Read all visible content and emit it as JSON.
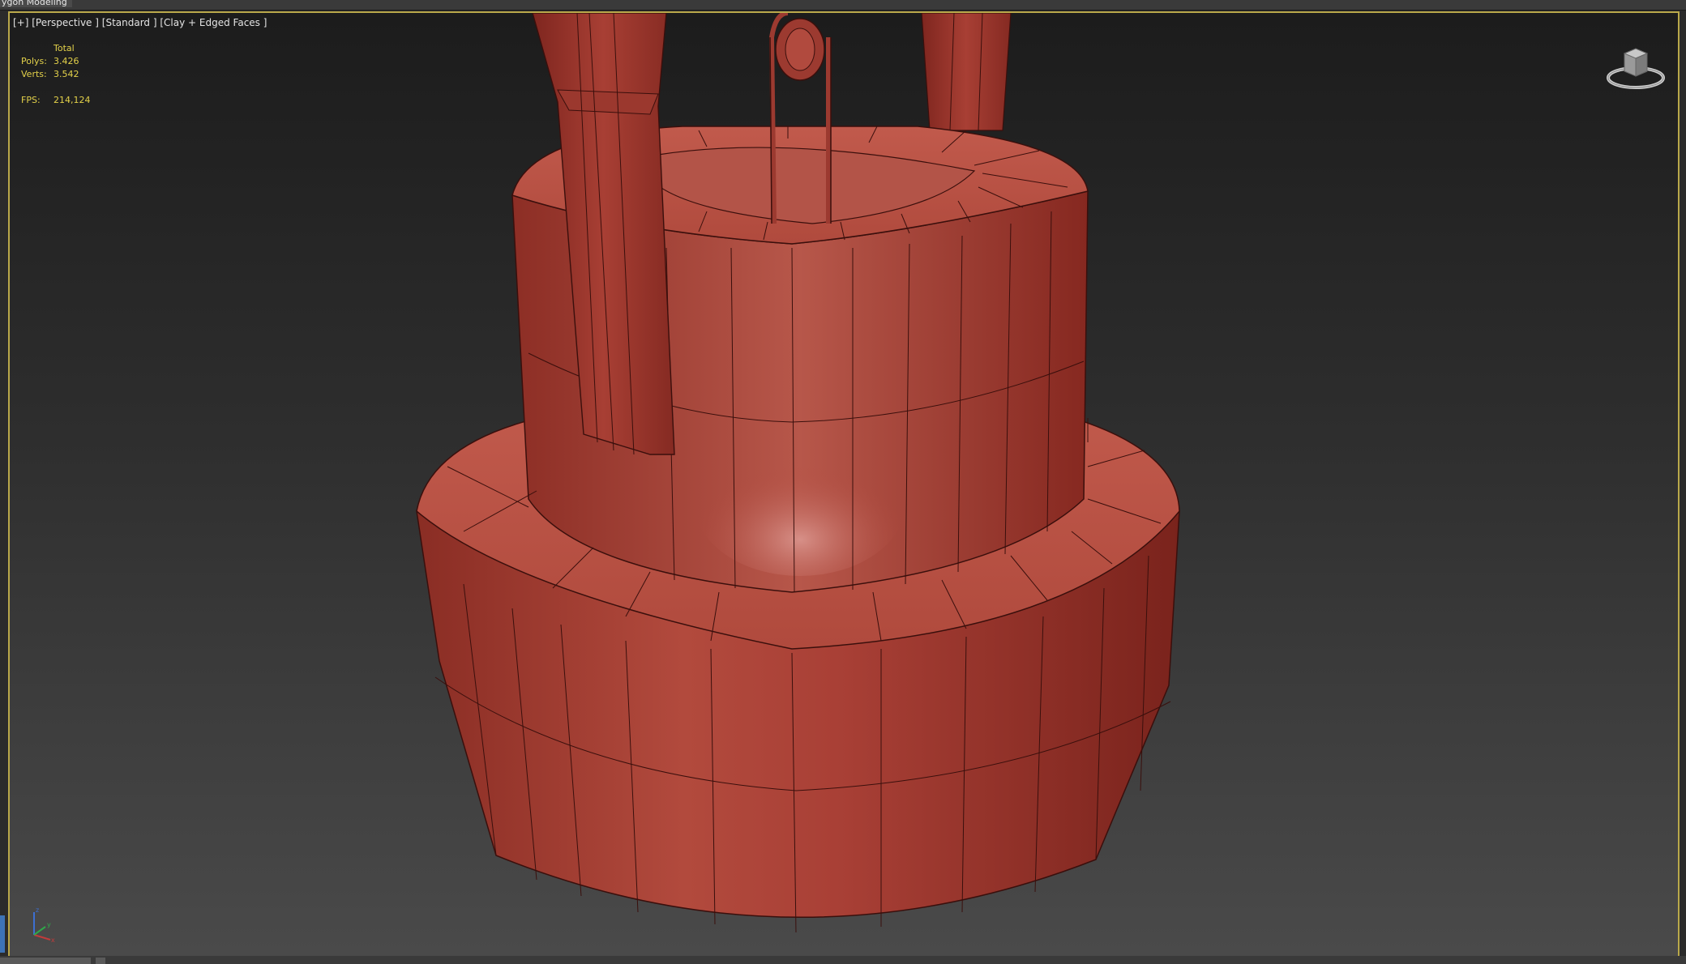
{
  "app": {
    "mode_label": "ygon Modeling"
  },
  "viewport": {
    "label_parts": [
      "[+]",
      "[Perspective ]",
      "[Standard ]",
      "[Clay + Edged Faces ]"
    ],
    "stats": {
      "total_label": "Total",
      "polys_label": "Polys:",
      "polys_value": "3.426",
      "verts_label": "Verts:",
      "verts_value": "3.542",
      "fps_label": "FPS:",
      "fps_value": "214,124"
    },
    "axis": {
      "x": "x",
      "y": "y",
      "z": "z"
    }
  },
  "colors": {
    "model_clay": "#b4493c",
    "model_dark": "#7d2620",
    "edges": "#3a0f0c",
    "viewport_border": "#b9a84a",
    "stats_text": "#e3d14a"
  },
  "icons": [
    "viewcube-icon",
    "axis-tripod-icon"
  ]
}
